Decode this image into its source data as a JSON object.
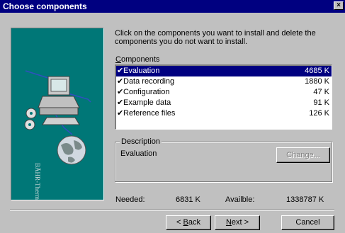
{
  "window": {
    "title": "Choose components",
    "close_glyph": "×"
  },
  "panel": {
    "vertical_text": "BÄHR-Thermoanalyse"
  },
  "instructions": "Click on the components you want to install and delete the components you do not want to install.",
  "components_label": {
    "accesskey": "C",
    "rest": "omponents"
  },
  "components": [
    {
      "name": "Evaluation",
      "size": "4685 K",
      "checked": true,
      "selected": true
    },
    {
      "name": "Data recording",
      "size": "1880 K",
      "checked": true,
      "selected": false
    },
    {
      "name": "Configuration",
      "size": "47 K",
      "checked": true,
      "selected": false
    },
    {
      "name": "Example data",
      "size": "91 K",
      "checked": true,
      "selected": false
    },
    {
      "name": "Reference files",
      "size": "126 K",
      "checked": true,
      "selected": false
    }
  ],
  "check_glyph": "✔",
  "description": {
    "legend": "Description",
    "text": "Evaluation",
    "change_button": "Change..."
  },
  "stats": {
    "needed_label": "Needed:",
    "needed_value": "6831 K",
    "available_label": "Availble:",
    "available_value": "1338787 K"
  },
  "buttons": {
    "back": {
      "prefix": "< ",
      "accesskey": "B",
      "rest": "ack"
    },
    "next": {
      "accesskey": "N",
      "rest": "ext >"
    },
    "cancel": "Cancel"
  },
  "colors": {
    "title_bar": "#000080",
    "panel_bg": "#007777",
    "selection": "#000080",
    "dialog_bg": "#c0c0c0"
  }
}
